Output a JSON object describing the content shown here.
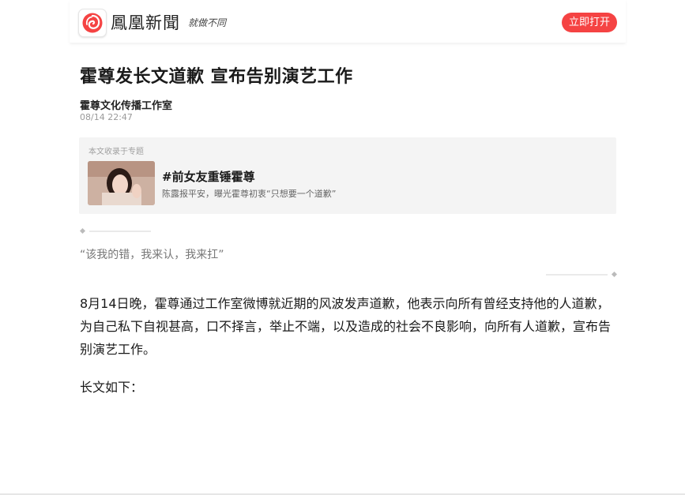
{
  "header": {
    "logo_name": "鳳凰新聞",
    "logo_slogan": "就做不同",
    "open_button_label": "立即打开",
    "logo_icon": "phoenix-logo-icon",
    "accent_color": "#f54343"
  },
  "article": {
    "title": "霍尊发长文道歉 宣布告别演艺工作",
    "author": "霍尊文化传播工作室",
    "time": "08/14 22:47"
  },
  "topic": {
    "label": "本文收录于专题",
    "title": "#前女友重锤霍尊",
    "subtitle": "陈露报平安，曝光霍尊初衷“只想要一个道歉”"
  },
  "quote": {
    "text": "“该我的错，我来认，我来扛”"
  },
  "body": {
    "paragraph1": "8月14日晚，霍尊通过工作室微博就近期的风波发声道歉，他表示向所有曾经支持他的人道歉，为自己私下自视甚高，口不择言，举止不端，以及造成的社会不良影响，向所有人道歉，宣布告别演艺工作。",
    "paragraph2": "长文如下："
  }
}
